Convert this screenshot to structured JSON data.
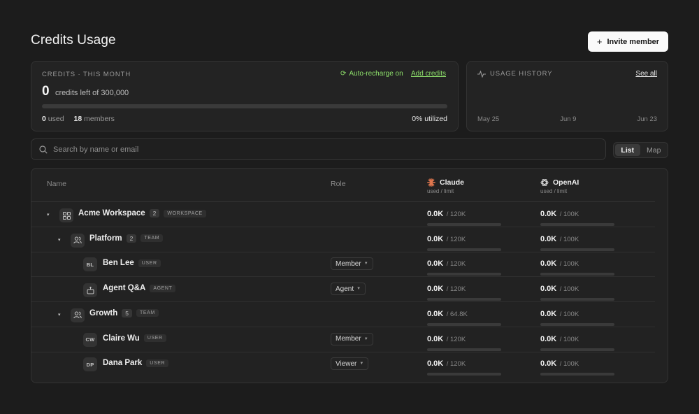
{
  "header": {
    "title": "Credits Usage",
    "invite_label": "Invite member"
  },
  "credits": {
    "caption": "CREDITS · THIS MONTH",
    "auto_recharge": "Auto-recharge on",
    "add_credits": "Add credits",
    "left": "0",
    "left_text": "credits left of 300,000",
    "progress": 0,
    "used_value": "0",
    "used_label": "used",
    "members_value": "18",
    "members_label": "members",
    "utilized": "0% utilized"
  },
  "history": {
    "caption": "USAGE HISTORY",
    "see_all": "See all",
    "dates": [
      "May 25",
      "Jun 9",
      "Jun 23"
    ]
  },
  "search": {
    "placeholder": "Search by name or email",
    "value": ""
  },
  "view_toggle": {
    "list": "List",
    "map": "Map",
    "active": "list"
  },
  "table": {
    "columns": {
      "name": "Name",
      "role": "Role"
    },
    "providers": [
      {
        "name": "Claude",
        "sub": "used / limit",
        "icon": "claude-icon",
        "color": "#e2784f"
      },
      {
        "name": "OpenAI",
        "sub": "used / limit",
        "icon": "openai-icon",
        "color": "#d8d8d8"
      }
    ],
    "rows": [
      {
        "kind": "workspace",
        "level": 0,
        "caret": "▾",
        "name": "Acme Workspace",
        "count": "2",
        "tag": "WORKSPACE",
        "role": "",
        "claude_used": "0.0K",
        "claude_limit": "/ 120K",
        "claude_fill": 0,
        "openai_used": "0.0K",
        "openai_limit": "/ 100K",
        "openai_fill": 0
      },
      {
        "kind": "team",
        "level": 1,
        "caret": "▾",
        "name": "Platform",
        "count": "2",
        "tag": "TEAM",
        "role": "",
        "claude_used": "0.0K",
        "claude_limit": "/ 120K",
        "claude_fill": 0,
        "openai_used": "0.0K",
        "openai_limit": "/ 100K",
        "openai_fill": 0
      },
      {
        "kind": "user",
        "level": 2,
        "initials": "BL",
        "name": "Ben Lee",
        "tag": "USER",
        "role": "Member",
        "claude_used": "0.0K",
        "claude_limit": "/ 120K",
        "claude_fill": 0,
        "openai_used": "0.0K",
        "openai_limit": "/ 100K",
        "openai_fill": 0
      },
      {
        "kind": "agent",
        "level": 2,
        "name": "Agent Q&A",
        "tag": "AGENT",
        "role": "Agent",
        "claude_used": "0.0K",
        "claude_limit": "/ 120K",
        "claude_fill": 0,
        "openai_used": "0.0K",
        "openai_limit": "/ 100K",
        "openai_fill": 0
      },
      {
        "kind": "team",
        "level": 1,
        "caret": "▾",
        "name": "Growth",
        "count": "5",
        "tag": "TEAM",
        "role": "",
        "claude_used": "0.0K",
        "claude_limit": "/ 64.8K",
        "claude_fill": 0,
        "openai_used": "0.0K",
        "openai_limit": "/ 100K",
        "openai_fill": 0
      },
      {
        "kind": "user",
        "level": 2,
        "initials": "CW",
        "name": "Claire Wu",
        "tag": "USER",
        "role": "Member",
        "claude_used": "0.0K",
        "claude_limit": "/ 120K",
        "claude_fill": 0,
        "openai_used": "0.0K",
        "openai_limit": "/ 100K",
        "openai_fill": 0
      },
      {
        "kind": "user",
        "level": 2,
        "initials": "DP",
        "name": "Dana Park",
        "tag": "USER",
        "role": "Viewer",
        "claude_used": "0.0K",
        "claude_limit": "/ 120K",
        "claude_fill": 0,
        "openai_used": "0.0K",
        "openai_limit": "/ 100K",
        "openai_fill": 0
      }
    ]
  },
  "colors": {
    "accent": "#8ee06b",
    "background": "#1c1c1c",
    "card": "#232323"
  }
}
